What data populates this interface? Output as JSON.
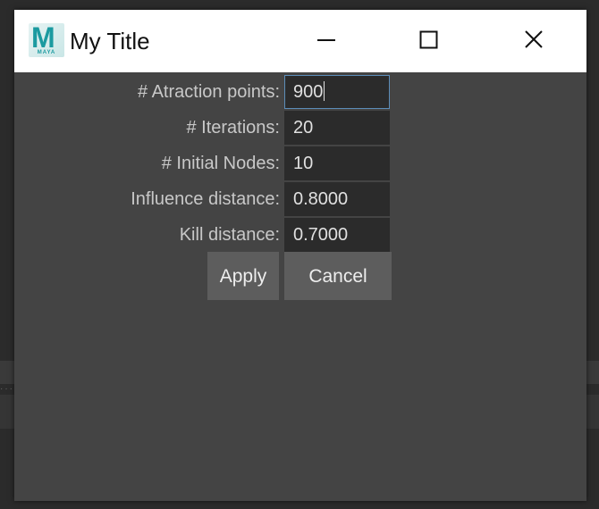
{
  "window": {
    "title": "My Title",
    "icon_name": "maya-app-icon",
    "icon_letter": "M",
    "icon_caption": "MAYA"
  },
  "title_controls": {
    "minimize": "minimize-icon",
    "maximize": "maximize-icon",
    "close": "close-icon"
  },
  "form": {
    "attraction_points": {
      "label": "# Atraction points:",
      "value": "900"
    },
    "iterations": {
      "label": "# Iterations:",
      "value": "20"
    },
    "initial_nodes": {
      "label": "# Initial Nodes:",
      "value": "10"
    },
    "influence_distance": {
      "label": "Influence distance:",
      "value": "0.8000"
    },
    "kill_distance": {
      "label": "Kill distance:",
      "value": "0.7000"
    }
  },
  "buttons": {
    "apply": "Apply",
    "cancel": "Cancel"
  },
  "colors": {
    "window_bg": "#444444",
    "field_bg": "#2b2b2b",
    "focus_border": "#5c8db8",
    "button_bg": "#5d5d5d",
    "brand": "#1b9aa0"
  }
}
